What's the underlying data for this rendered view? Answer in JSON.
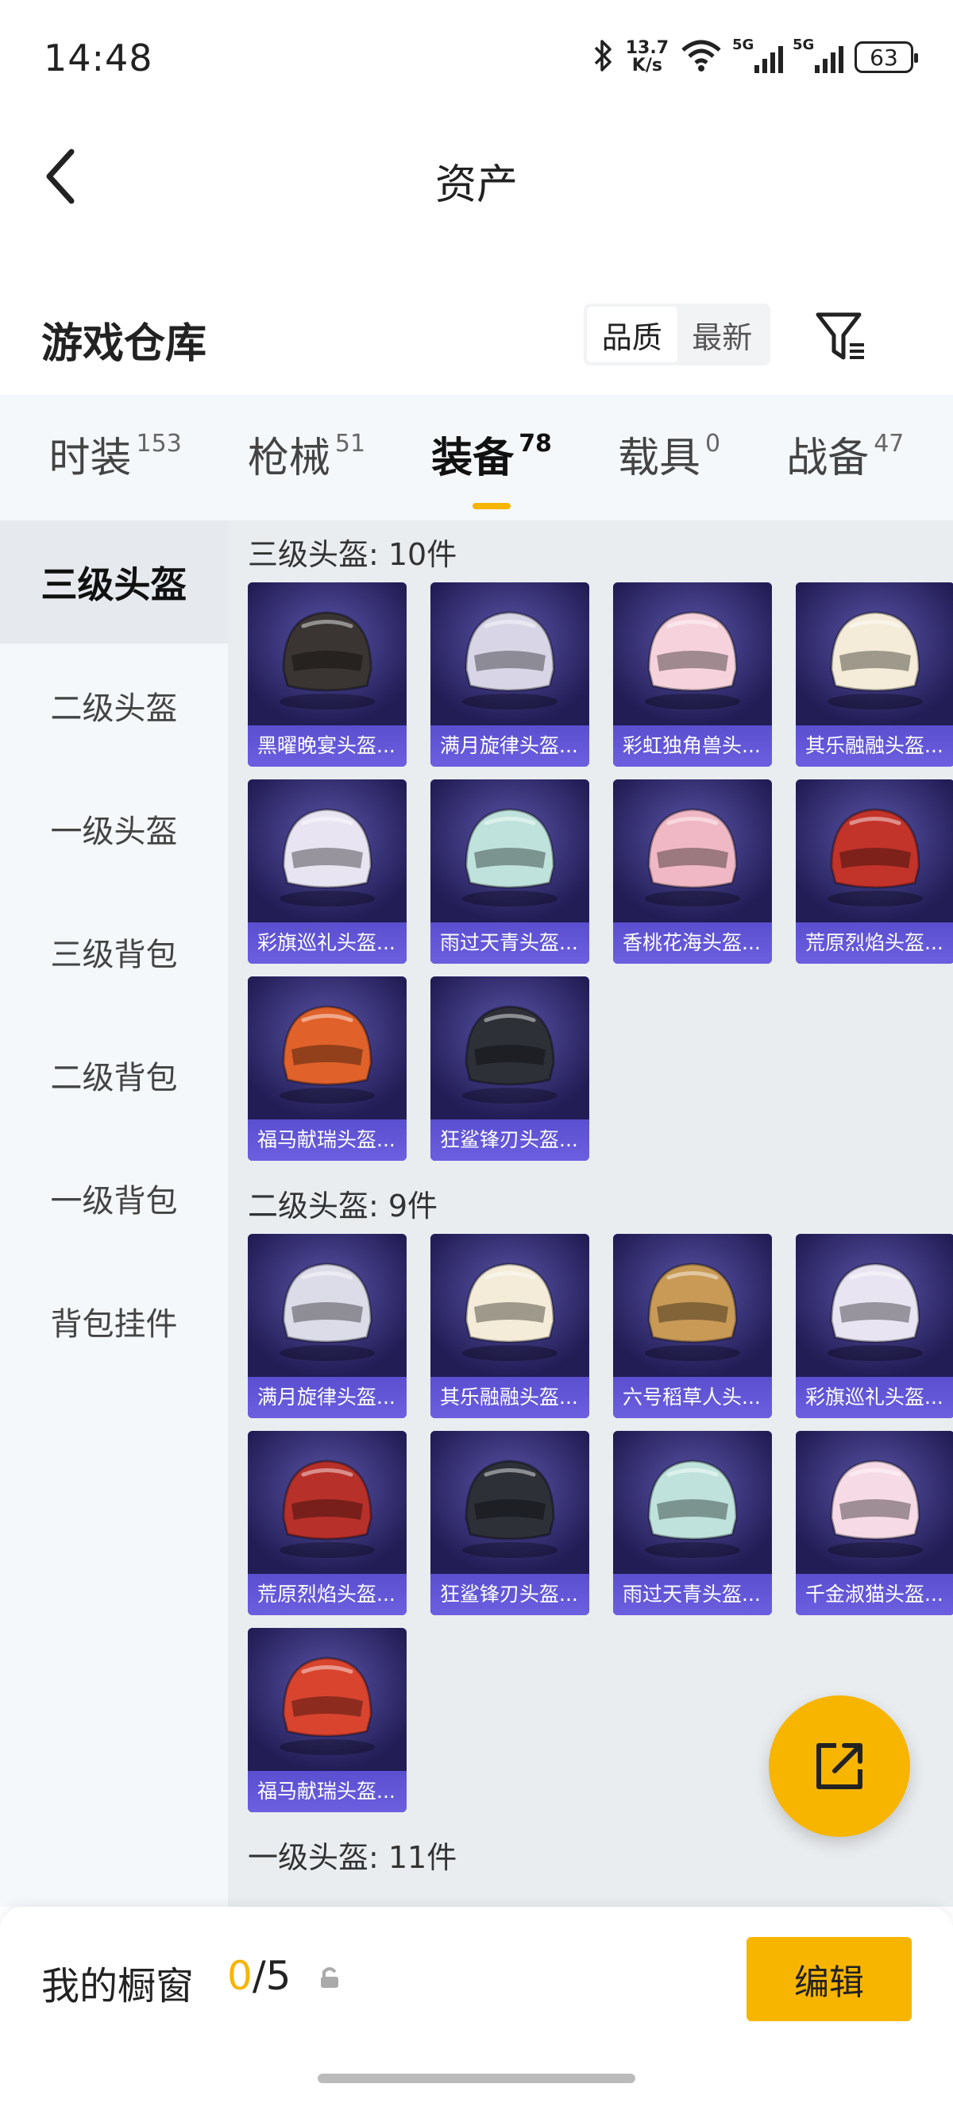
{
  "status_bar": {
    "time": "14:48",
    "net_speed_value": "13.7",
    "net_speed_unit": "K/s",
    "signal1": "5G",
    "signal2": "5G",
    "battery": "63",
    "icons": [
      "bluetooth-icon",
      "wifi-icon",
      "signal-icon",
      "battery-icon"
    ]
  },
  "nav": {
    "title": "资产",
    "back_icon": "chevron-left-icon"
  },
  "section": {
    "title": "游戏仓库",
    "sort_options": [
      "品质",
      "最新"
    ],
    "active_sort": "品质",
    "filter_icon": "filter-icon"
  },
  "tabs": [
    {
      "label": "时装",
      "count": "153",
      "active": false
    },
    {
      "label": "枪械",
      "count": "51",
      "active": false
    },
    {
      "label": "装备",
      "count": "78",
      "active": true
    },
    {
      "label": "载具",
      "count": "0",
      "active": false
    },
    {
      "label": "战备",
      "count": "47",
      "active": false
    }
  ],
  "sidebar": [
    {
      "label": "三级头盔",
      "active": true
    },
    {
      "label": "二级头盔",
      "active": false
    },
    {
      "label": "一级头盔",
      "active": false
    },
    {
      "label": "三级背包",
      "active": false
    },
    {
      "label": "二级背包",
      "active": false
    },
    {
      "label": "一级背包",
      "active": false
    },
    {
      "label": "背包挂件",
      "active": false
    }
  ],
  "groups": [
    {
      "title": "三级头盔: 10件",
      "items": [
        {
          "name": "黑曜晚宴头盔...",
          "icon": "helmet-icon",
          "color": "#3a3532"
        },
        {
          "name": "满月旋律头盔...",
          "icon": "helmet-icon",
          "color": "#d8d6e6"
        },
        {
          "name": "彩虹独角兽头...",
          "icon": "helmet-icon",
          "color": "#f6d3dc"
        },
        {
          "name": "其乐融融头盔...",
          "icon": "helmet-icon",
          "color": "#f4ecd8"
        },
        {
          "name": "彩旗巡礼头盔...",
          "icon": "helmet-icon",
          "color": "#e9e4f2"
        },
        {
          "name": "雨过天青头盔...",
          "icon": "helmet-icon",
          "color": "#bfe3dc"
        },
        {
          "name": "香桃花海头盔...",
          "icon": "helmet-icon",
          "color": "#f0b8c4"
        },
        {
          "name": "荒原烈焰头盔...",
          "icon": "helmet-icon",
          "color": "#c2332a"
        },
        {
          "name": "福马献瑞头盔...",
          "icon": "helmet-icon",
          "color": "#e0622a"
        },
        {
          "name": "狂鲨锋刃头盔...",
          "icon": "helmet-icon",
          "color": "#2e3038"
        }
      ]
    },
    {
      "title": "二级头盔: 9件",
      "items": [
        {
          "name": "满月旋律头盔...",
          "icon": "helmet-icon",
          "color": "#dcdbe8"
        },
        {
          "name": "其乐融融头盔...",
          "icon": "helmet-icon",
          "color": "#f4ecd8"
        },
        {
          "name": "六号稻草人头...",
          "icon": "helmet-icon",
          "color": "#c89a56"
        },
        {
          "name": "彩旗巡礼头盔...",
          "icon": "helmet-icon",
          "color": "#e9e4f2"
        },
        {
          "name": "荒原烈焰头盔...",
          "icon": "helmet-icon",
          "color": "#b8302a"
        },
        {
          "name": "狂鲨锋刃头盔...",
          "icon": "helmet-icon",
          "color": "#2e3038"
        },
        {
          "name": "雨过天青头盔...",
          "icon": "helmet-icon",
          "color": "#bfe3dc"
        },
        {
          "name": "千金淑猫头盔...",
          "icon": "helmet-icon",
          "color": "#f6dbe6"
        },
        {
          "name": "福马献瑞头盔...",
          "icon": "helmet-icon",
          "color": "#d9442e"
        }
      ]
    },
    {
      "title": "一级头盔: 11件",
      "items": []
    }
  ],
  "fab": {
    "icon": "share-icon"
  },
  "bottom_bar": {
    "label": "我的橱窗",
    "current": "0",
    "total": "/5",
    "lock_icon": "lock-icon",
    "edit_label": "编辑"
  },
  "colors": {
    "accent": "#f7b500",
    "card_bg": "#2a2466",
    "card_caption": "#5a4fcf"
  }
}
